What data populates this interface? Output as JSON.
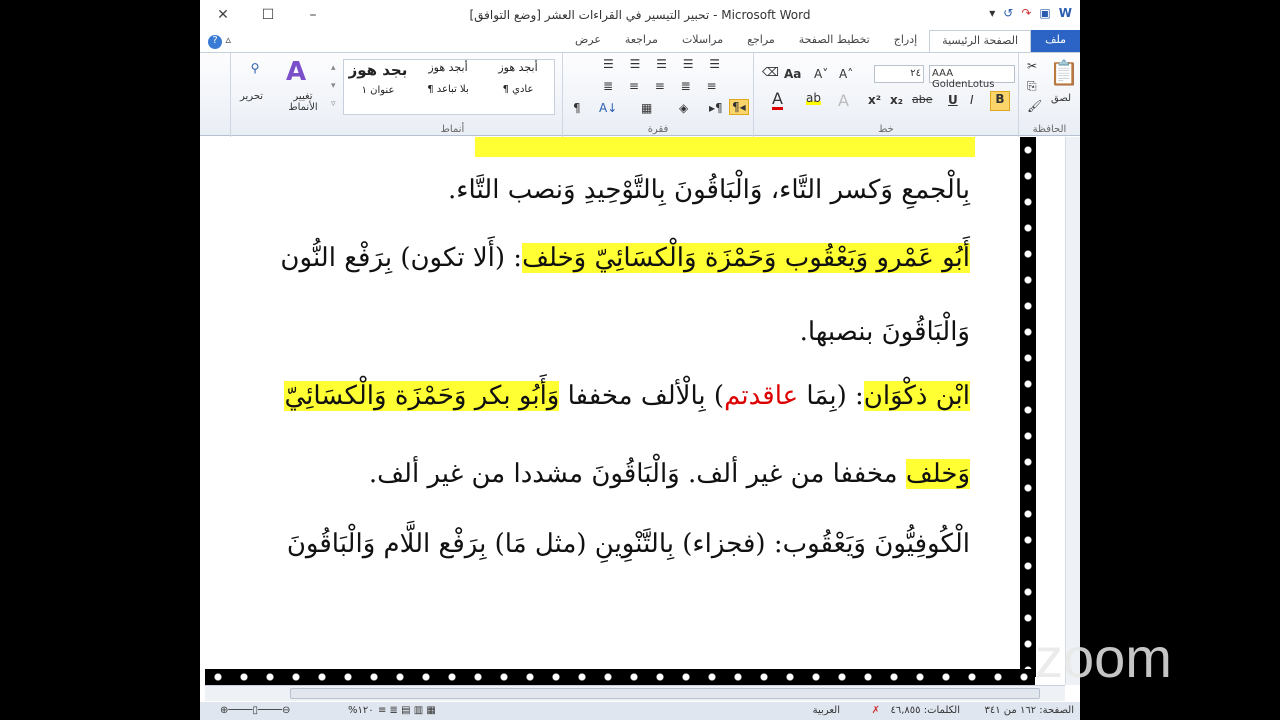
{
  "window": {
    "title": "تحبير التيسير في القراءات العشر [وضع التوافق] - Microsoft Word"
  },
  "tabs": [
    "ملف",
    "الصفحة الرئيسية",
    "إدراج",
    "تخطيط الصفحة",
    "مراجع",
    "مراسلات",
    "مراجعة",
    "عرض"
  ],
  "ribbon": {
    "clipboard": {
      "label": "الحافظة",
      "paste": "لصق"
    },
    "font": {
      "label": "خط",
      "name": "AAA GoldenLotus",
      "size": "٢٤"
    },
    "paragraph": {
      "label": "فقرة"
    },
    "styles": {
      "label": "أنماط",
      "items": [
        {
          "sample": "أبجد هوز",
          "name": "¶ عادي"
        },
        {
          "sample": "أبجد هوز",
          "name": "¶ بلا تباعد"
        },
        {
          "sample": "بجد هوز",
          "name": "عنوان ١"
        }
      ],
      "change": "تغيير الأنماط"
    },
    "editing": {
      "label": "تحرير"
    }
  },
  "document": {
    "line1": "بِالْجمعِ وَكسر التَّاء، وَالْبَاقُونَ بِالتَّوْحِيدِ وَنصب التَّاء.",
    "line2a": "أَبُو عَمْرو وَيَعْقُوب وَحَمْزَة وَالْكسَائِيّ وَخلف",
    "line2b": ": (أَلا تكون) بِرَفْع النُّون",
    "line3": "وَالْبَاقُونَ بنصبها.",
    "line4a": "ابْن ذكْوَان",
    "line4b": ": (بِمَا ",
    "line4c": "عاقدتم",
    "line4d": ") بِالْألف مخففا ",
    "line4e": "وَأَبُو بكر وَحَمْزَة وَالْكسَائِيّ",
    "line5a": "وَخلف",
    "line5b": " مخففا من غير ألف. وَالْبَاقُونَ مشددا من غير ألف.",
    "line6": "الْكُوفِيُّونَ وَيَعْقُوب: (فجزاء) بِالتَّنْوِينِ (مثل مَا) بِرَفْع اللَّام وَالْبَاقُونَ"
  },
  "status": {
    "page": "الصفحة: ١٦٢ من ٣٤١",
    "words": "الكلمات: ٤٦,٨٥٥",
    "language": "العربية",
    "zoom": "%١٢٠"
  },
  "overlay": {
    "logo": "zoom"
  }
}
